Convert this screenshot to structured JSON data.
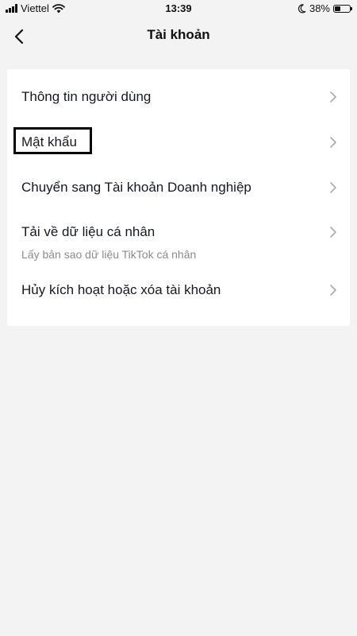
{
  "status_bar": {
    "carrier": "Viettel",
    "time": "13:39",
    "battery_percent": "38%",
    "battery_level": 0.38,
    "icons": [
      "signal-icon",
      "wifi-icon",
      "moon-icon",
      "battery-icon"
    ]
  },
  "header": {
    "title": "Tài khoản",
    "back_icon": "chevron-left-icon"
  },
  "menu": {
    "items": [
      {
        "label": "Thông tin người dùng"
      },
      {
        "label": "Mật khẩu",
        "highlighted": true
      },
      {
        "label": "Chuyển sang Tài khoản Doanh nghiệp"
      },
      {
        "label": "Tải về dữ liệu cá nhân",
        "subtitle": "Lấy bản sao dữ liệu TikTok cá nhân"
      },
      {
        "label": "Hủy kích hoạt hoặc xóa tài khoản"
      }
    ]
  },
  "colors": {
    "background": "#f3f3f3",
    "card": "#ffffff",
    "text_primary": "#161823",
    "text_secondary": "#8a8b91",
    "chevron": "#a8a9ae"
  }
}
